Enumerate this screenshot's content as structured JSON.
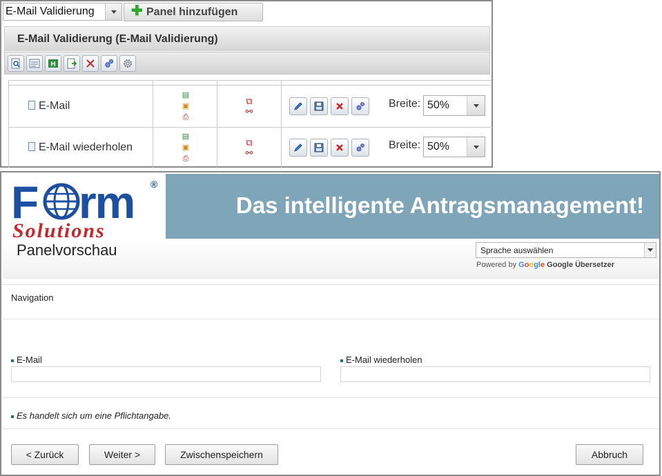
{
  "editor": {
    "panel_select_value": "E-Mail Validierung",
    "add_panel_label": "Panel hinzufügen",
    "add_panel_icon": "plus-icon",
    "header_title": "E-Mail Validierung (E-Mail Validierung)",
    "toolbar_icons": [
      "preview-icon",
      "properties-icon",
      "html-icon",
      "export-icon",
      "delete-icon",
      "settings-icon",
      "gear-icon"
    ],
    "elements": [
      {
        "name": "E-Mail",
        "width_label": "Breite:",
        "width_value": "50%"
      },
      {
        "name": "E-Mail wiederholen",
        "width_label": "Breite:",
        "width_value": "50%"
      }
    ],
    "row_action_icons": [
      "edit-icon",
      "save-icon",
      "delete-icon",
      "settings-icon"
    ],
    "accent_colors": {
      "plus": "#2fa82f",
      "delete": "#d22222",
      "logic": "#b52222"
    }
  },
  "preview": {
    "logo_text_main": "Form",
    "logo_text_sub": "Solutions",
    "logo_registered": "®",
    "banner_text": "Das intelligente Antragsmanagement!",
    "banner_color": "#7fa5b8",
    "title": "Panelvorschau",
    "language_select": "Sprache auswählen",
    "powered_by_prefix": "Powered by",
    "powered_by_google": "Google",
    "powered_by_service": "Google Übersetzer",
    "navigation_label": "Navigation",
    "fields": [
      {
        "label": "E-Mail",
        "value": ""
      },
      {
        "label": "E-Mail wiederholen",
        "value": ""
      }
    ],
    "required_hint": "Es handelt sich um eine Pflichtangabe.",
    "buttons": {
      "back": "< Zurück",
      "next": "Weiter >",
      "save": "Zwischenspeichern",
      "cancel": "Abbruch"
    }
  }
}
